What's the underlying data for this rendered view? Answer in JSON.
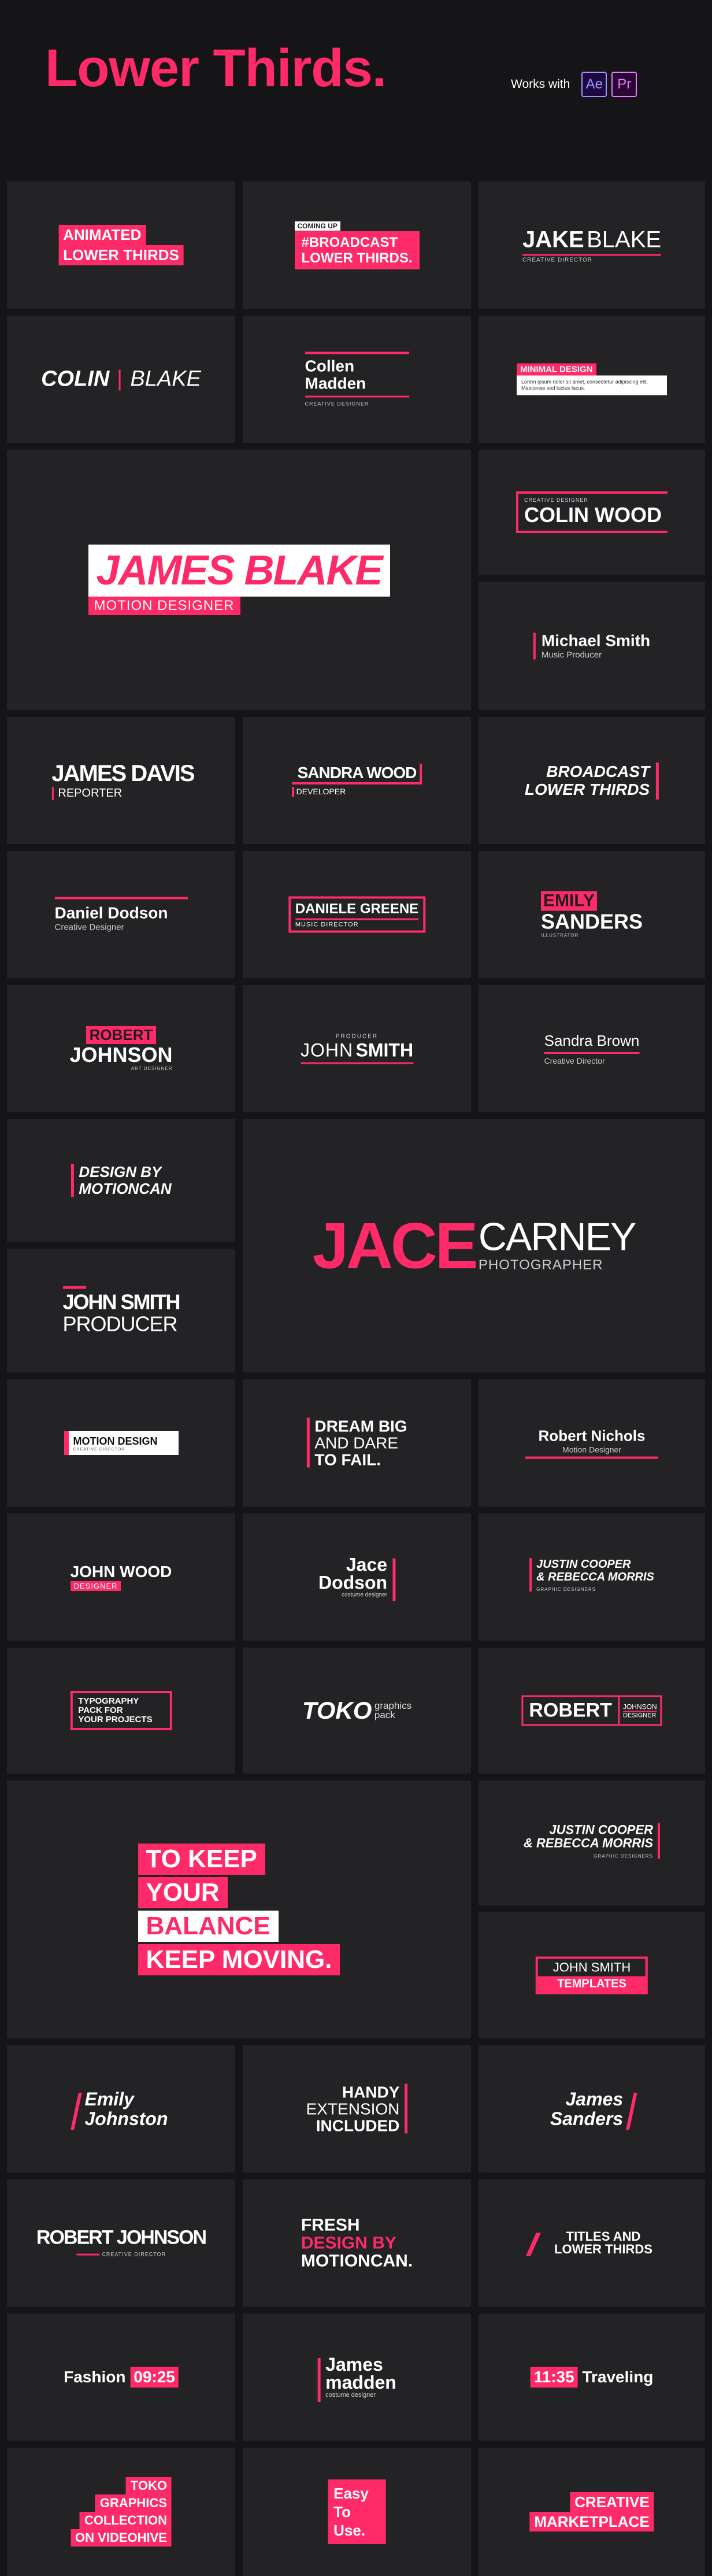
{
  "header": {
    "title": "Lower Thirds.",
    "works_with": "Works with",
    "badges": [
      "Ae",
      "Pr"
    ]
  },
  "colors": {
    "accent": "#ff2a68",
    "bg": "#151517",
    "tile": "#232325",
    "ae": "#9999ff",
    "ae_bg": "#1f0740",
    "pr": "#e77cff",
    "pr_bg": "#2a0634"
  },
  "tiles": {
    "t1": [
      "ANIMATED",
      "LOWER THIRDS"
    ],
    "t2": [
      "COMING UP",
      "#BROADCAST",
      "LOWER THIRDS."
    ],
    "t3": {
      "first": "JAKE",
      "last": "BLAKE",
      "role": "CREATIVE DIRECTOR"
    },
    "t4": {
      "first": "COLIN",
      "last": "BLAKE"
    },
    "t5": {
      "name": "Collen",
      "name2": "Madden",
      "role": "CREATIVE DESIGNER"
    },
    "t6": {
      "title": "MINIMAL DESIGN",
      "body": "Lorem ipsum dolor sit amet, consectetur adipiscing elit. Maecenas sed luctus lacus."
    },
    "t7": {
      "name": "JAMES BLAKE",
      "role": "MOTION DESIGNER"
    },
    "t8": {
      "pre": "CREATIVE DESIGNER",
      "name": "COLIN WOOD"
    },
    "t9": {
      "name": "Michael Smith",
      "role": "Music Producer"
    },
    "t10": {
      "name": "JAMES DAVIS",
      "role": "REPORTER"
    },
    "t11": {
      "name": "SANDRA WOOD",
      "role": "DEVELOPER"
    },
    "t12": [
      "BROADCAST",
      "LOWER THIRDS"
    ],
    "t13": {
      "name": "Daniel Dodson",
      "role": "Creative Designer"
    },
    "t14": {
      "name": "DANIELE GREENE",
      "role": "MUSIC DIRECTOR"
    },
    "t15": {
      "first": "EMILY",
      "last": "SANDERS",
      "role": "ILLUSTRATOR"
    },
    "t16": {
      "first": "ROBERT",
      "last": "JOHNSON",
      "role": "ART DESIGNER"
    },
    "t17": {
      "pre": "PRODUCER",
      "first": "JOHN",
      "last": "SMITH"
    },
    "t18": {
      "name": "Sandra Brown",
      "role": "Creative Director"
    },
    "t19": [
      "DESIGN BY",
      "MOTIONCAN"
    ],
    "t20": {
      "first": "JACE",
      "last": "CARNEY",
      "role": "PHOTOGRAPHER"
    },
    "t21": {
      "name": "JOHN SMITH",
      "role": "PRODUCER"
    },
    "t22": {
      "name": "MOTION DESIGN",
      "role": "CREATIVE DIRECTOR"
    },
    "t23": [
      "DREAM BIG",
      "AND DARE",
      "TO FAIL."
    ],
    "t24": {
      "name": "Robert Nichols",
      "role": "Motion Designer"
    },
    "t25": {
      "name": "JOHN WOOD",
      "role": "DESIGNER"
    },
    "t26": {
      "name": "Jace",
      "name2": "Dodson",
      "role": "costume designer"
    },
    "t27": {
      "name": "JUSTIN COOPER",
      "name2": "& REBECCA MORRIS",
      "role": "GRAPHIC DESIGNERS"
    },
    "t28": [
      "TYPOGRAPHY",
      "PACK FOR",
      "YOUR PROJECTS"
    ],
    "t29": {
      "name": "TOKO",
      "sub1": "graphics",
      "sub2": "pack"
    },
    "t30": {
      "name": "ROBERT",
      "last": "JOHNSON",
      "role": "DESIGNER"
    },
    "t31": [
      "TO KEEP",
      "YOUR",
      "BALANCE",
      "KEEP MOVING."
    ],
    "t32": {
      "name": "JUSTIN COOPER",
      "name2": "& REBECCA MORRIS",
      "role": "GRAPHIC DESIGNERS"
    },
    "t33": {
      "name": "JOHN SMITH",
      "role": "TEMPLATES"
    },
    "t34": [
      "Emily",
      "Johnston"
    ],
    "t35": [
      "HANDY",
      "EXTENSION",
      "INCLUDED"
    ],
    "t36": [
      "James",
      "Sanders"
    ],
    "t37": {
      "name": "ROBERT JOHNSON",
      "role": "CREATIVE DIRECTOR"
    },
    "t38": [
      "FRESH",
      "DESIGN BY",
      "MOTIONCAN."
    ],
    "t39": [
      "TITLES AND",
      "LOWER THIRDS"
    ],
    "t40": {
      "label": "Fashion",
      "time": "09:25"
    },
    "t41": {
      "name": "James",
      "name2": "madden",
      "role": "costume designer"
    },
    "t42": {
      "time": "11:35",
      "label": "Traveling"
    },
    "t43": [
      "TOKO",
      "GRAPHICS",
      "COLLECTION",
      "ON VIDEOHIVE"
    ],
    "t44": [
      "Easy",
      "To",
      "Use."
    ],
    "t45": [
      "CREATIVE",
      "MARKETPLACE"
    ]
  }
}
